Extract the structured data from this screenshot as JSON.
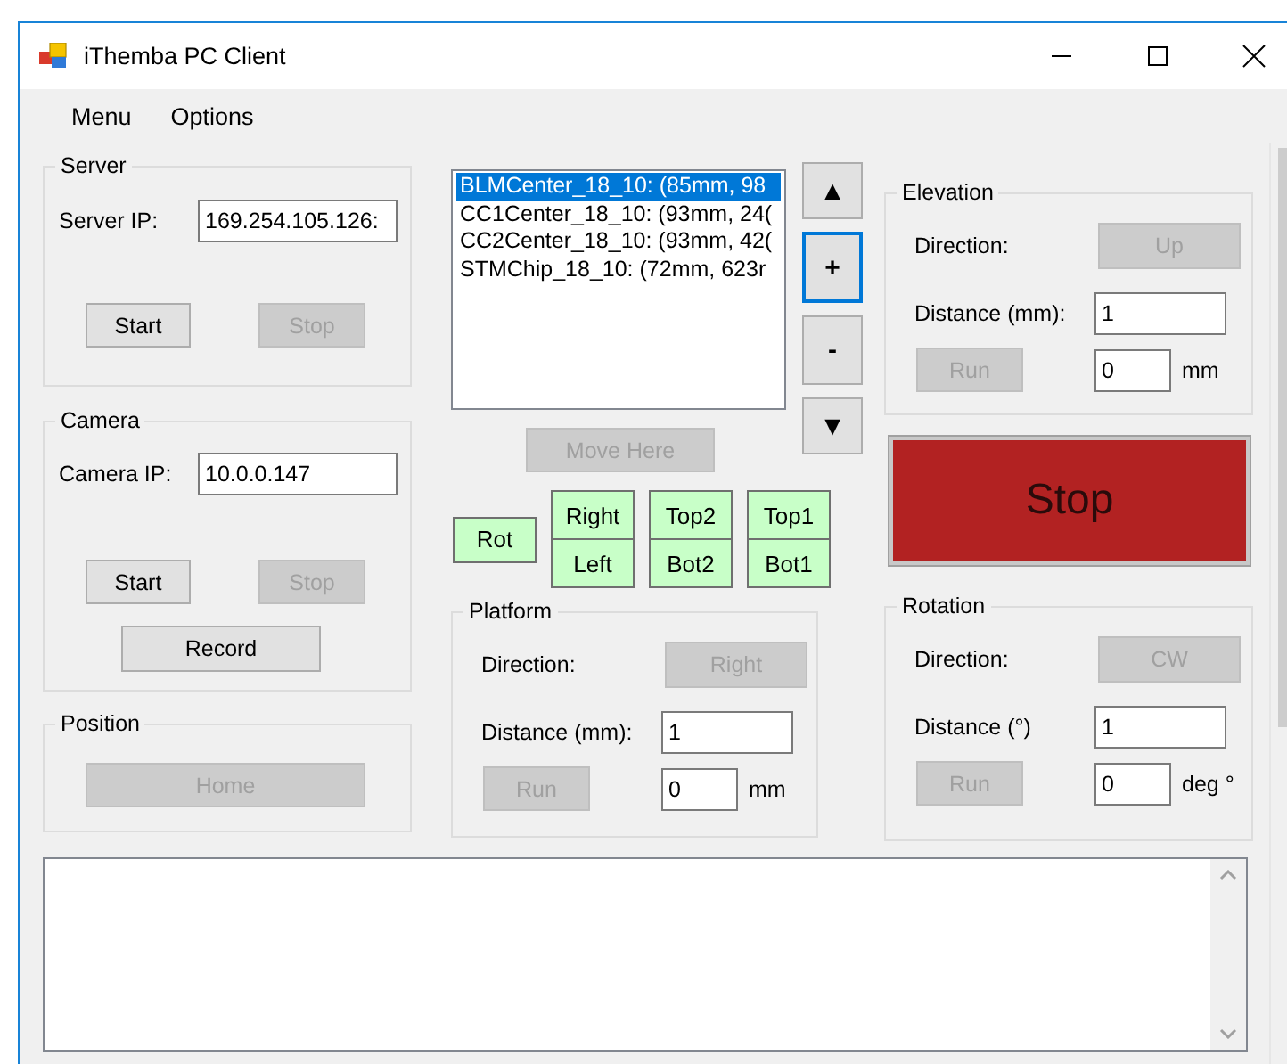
{
  "window": {
    "title": "iThemba PC Client"
  },
  "menu": [
    {
      "label": "Menu"
    },
    {
      "label": "Options"
    }
  ],
  "server": {
    "title": "Server",
    "ip_label": "Server IP:",
    "ip_value": "169.254.105.126:",
    "buttons": [
      {
        "label": "Start",
        "disabled": false
      },
      {
        "label": "Stop",
        "disabled": true
      }
    ]
  },
  "camera": {
    "title": "Camera",
    "ip_label": "Camera IP:",
    "ip_value": "10.0.0.147",
    "buttons": [
      {
        "label": "Start",
        "disabled": false
      },
      {
        "label": "Stop",
        "disabled": true
      }
    ],
    "record": {
      "label": "Record",
      "disabled": false
    }
  },
  "position": {
    "title": "Position",
    "home": {
      "label": "Home",
      "disabled": true
    }
  },
  "presets": [
    {
      "label": "BLMCenter_18_10: (85mm, 98",
      "selected": true
    },
    {
      "label": "CC1Center_18_10: (93mm, 24(",
      "selected": false
    },
    {
      "label": "CC2Center_18_10: (93mm, 42(",
      "selected": false
    },
    {
      "label": "STMChip_18_10: (72mm, 623r",
      "selected": false
    }
  ],
  "list_buttons": [
    {
      "label": "▲",
      "focused": false
    },
    {
      "label": "+",
      "focused": true
    },
    {
      "label": "-",
      "focused": false
    },
    {
      "label": "▼",
      "focused": false
    }
  ],
  "move_here": {
    "label": "Move Here",
    "disabled": true
  },
  "targets": [
    {
      "buttons": [
        "Rot"
      ]
    },
    {
      "buttons": [
        "Right",
        "Left"
      ]
    },
    {
      "buttons": [
        "Top2",
        "Bot2"
      ]
    },
    {
      "buttons": [
        "Top1",
        "Bot1"
      ]
    }
  ],
  "platform": {
    "title": "Platform",
    "direction_label": "Direction:",
    "direction": {
      "label": "Right",
      "disabled": true
    },
    "distance_label": "Distance (mm):",
    "distance_value": "1",
    "run": {
      "label": "Run",
      "disabled": true
    },
    "position_value": "0",
    "unit": "mm"
  },
  "elevation": {
    "title": "Elevation",
    "direction_label": "Direction:",
    "direction": {
      "label": "Up",
      "disabled": true
    },
    "distance_label": "Distance (mm):",
    "distance_value": "1",
    "run": {
      "label": "Run",
      "disabled": true
    },
    "position_value": "0",
    "unit": "mm"
  },
  "stop_button": {
    "label": "Stop"
  },
  "rotation": {
    "title": "Rotation",
    "direction_label": "Direction:",
    "direction": {
      "label": "CW",
      "disabled": true
    },
    "distance_label": "Distance (°)",
    "distance_value": "1",
    "run": {
      "label": "Run",
      "disabled": true
    },
    "position_value": "0",
    "unit": "deg °"
  }
}
